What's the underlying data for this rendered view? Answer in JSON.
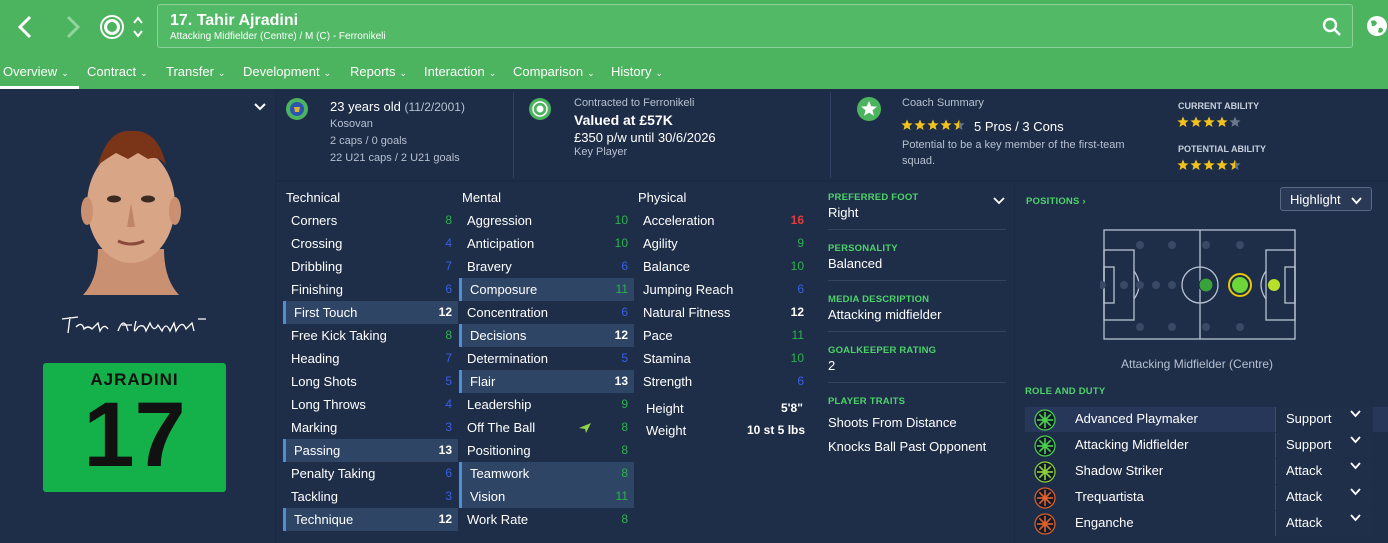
{
  "header": {
    "title": "17. Tahir Ajradini",
    "subtitle": "Attacking Midfielder (Centre) / M (C) - Ferronikeli"
  },
  "menu": [
    {
      "label": "Overview"
    },
    {
      "label": "Contract"
    },
    {
      "label": "Transfer"
    },
    {
      "label": "Development"
    },
    {
      "label": "Reports"
    },
    {
      "label": "Interaction"
    },
    {
      "label": "Comparison"
    },
    {
      "label": "History"
    }
  ],
  "player": {
    "kit_name": "AJRADINI",
    "kit_number": "17",
    "signature": "Tahir Ajradini"
  },
  "bio": {
    "age": "23 years old",
    "dob": "(11/2/2001)",
    "nationality": "Kosovan",
    "caps": "2 caps / 0 goals",
    "u21caps": "22 U21 caps / 2 U21 goals"
  },
  "contract": {
    "club_line": "Contracted to Ferronikeli",
    "value": "Valued at £57K",
    "wage": "£350 p/w until 30/6/2026",
    "status": "Key Player"
  },
  "coach": {
    "heading": "Coach Summary",
    "pros_cons": "5 Pros / 3 Cons",
    "rating_stars": 4.5,
    "summary1": "Potential to be a key member of the first-team",
    "summary2": "squad."
  },
  "ability": {
    "current_label": "CURRENT ABILITY",
    "current_stars": 4,
    "potential_label": "POTENTIAL ABILITY",
    "potential_stars": 4.5
  },
  "attributes": {
    "technical_label": "Technical",
    "mental_label": "Mental",
    "physical_label": "Physical",
    "technical": [
      {
        "name": "Corners",
        "value": "8"
      },
      {
        "name": "Crossing",
        "value": "4"
      },
      {
        "name": "Dribbling",
        "value": "7"
      },
      {
        "name": "Finishing",
        "value": "6"
      },
      {
        "name": "First Touch",
        "value": "12"
      },
      {
        "name": "Free Kick Taking",
        "value": "8"
      },
      {
        "name": "Heading",
        "value": "7"
      },
      {
        "name": "Long Shots",
        "value": "5"
      },
      {
        "name": "Long Throws",
        "value": "4"
      },
      {
        "name": "Marking",
        "value": "3"
      },
      {
        "name": "Passing",
        "value": "13"
      },
      {
        "name": "Penalty Taking",
        "value": "6"
      },
      {
        "name": "Tackling",
        "value": "3"
      },
      {
        "name": "Technique",
        "value": "12"
      }
    ],
    "mental": [
      {
        "name": "Aggression",
        "value": "10"
      },
      {
        "name": "Anticipation",
        "value": "10"
      },
      {
        "name": "Bravery",
        "value": "6"
      },
      {
        "name": "Composure",
        "value": "11"
      },
      {
        "name": "Concentration",
        "value": "6"
      },
      {
        "name": "Decisions",
        "value": "12"
      },
      {
        "name": "Determination",
        "value": "5"
      },
      {
        "name": "Flair",
        "value": "13"
      },
      {
        "name": "Leadership",
        "value": "9"
      },
      {
        "name": "Off The Ball",
        "value": "8"
      },
      {
        "name": "Positioning",
        "value": "8"
      },
      {
        "name": "Teamwork",
        "value": "8"
      },
      {
        "name": "Vision",
        "value": "11"
      },
      {
        "name": "Work Rate",
        "value": "8"
      }
    ],
    "physical": [
      {
        "name": "Acceleration",
        "value": "16"
      },
      {
        "name": "Agility",
        "value": "9"
      },
      {
        "name": "Balance",
        "value": "10"
      },
      {
        "name": "Jumping Reach",
        "value": "6"
      },
      {
        "name": "Natural Fitness",
        "value": "12"
      },
      {
        "name": "Pace",
        "value": "11"
      },
      {
        "name": "Stamina",
        "value": "10"
      },
      {
        "name": "Strength",
        "value": "6"
      }
    ],
    "height_label": "Height",
    "height": "5'8\"",
    "weight_label": "Weight",
    "weight": "10 st 5 lbs"
  },
  "details": {
    "foot_label": "PREFERRED FOOT",
    "foot": "Right",
    "personality_label": "PERSONALITY",
    "personality": "Balanced",
    "media_label": "MEDIA DESCRIPTION",
    "media": "Attacking midfielder",
    "gk_label": "GOALKEEPER RATING",
    "gk": "2",
    "traits_label": "PLAYER TRAITS",
    "traits": [
      "Shoots From Distance",
      "Knocks Ball Past Opponent"
    ]
  },
  "positions": {
    "label": "POSITIONS",
    "highlight": "Highlight",
    "caption": "Attacking Midfielder (Centre)",
    "role_duty_label": "ROLE AND DUTY",
    "roles": [
      {
        "name": "Advanced Playmaker",
        "duty": "Support"
      },
      {
        "name": "Attacking Midfielder",
        "duty": "Support"
      },
      {
        "name": "Shadow Striker",
        "duty": "Attack"
      },
      {
        "name": "Trequartista",
        "duty": "Attack"
      },
      {
        "name": "Enganche",
        "duty": "Attack"
      }
    ]
  },
  "colors": {
    "accent_green": "#4cb35f",
    "value_green": "#2bb34a",
    "value_blue": "#3a5fe8",
    "value_red": "#e33b3b",
    "panel_bg": "#1e2e48"
  }
}
